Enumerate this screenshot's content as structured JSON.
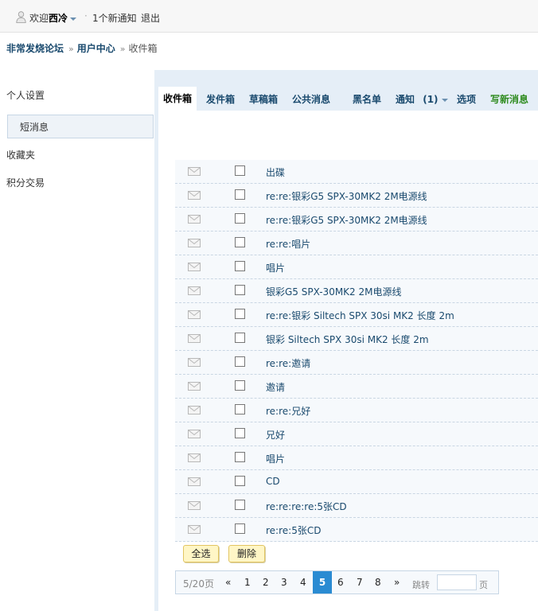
{
  "topbar": {
    "welcome_prefix": "欢迎",
    "username": "西冷",
    "separator": "·",
    "notice": "1个新通知",
    "logout": "退出"
  },
  "breadcrumb": {
    "forum": "非常发烧论坛",
    "sep": "»",
    "user_center": "用户中心",
    "current": "收件箱"
  },
  "sidebar": {
    "items": [
      "个人设置",
      "短消息",
      "收藏夹",
      "积分交易"
    ]
  },
  "tabs": {
    "inbox": "收件箱",
    "outbox": "发件箱",
    "drafts": "草稿箱",
    "public": "公共消息",
    "blacklist": "黑名单",
    "notice": "通知",
    "notice_count": "(1)",
    "options": "选项",
    "compose": "写新消息"
  },
  "messages": [
    "出碟",
    "re:re:银彩G5 SPX-30MK2 2M电源线",
    "re:re:银彩G5 SPX-30MK2 2M电源线",
    "re:re:唱片",
    "唱片",
    "银彩G5 SPX-30MK2 2M电源线",
    "re:re:银彩  Siltech SPX 30si MK2 长度  2m",
    "银彩  Siltech SPX 30si MK2 长度  2m",
    "re:re:邀请",
    "邀请",
    "re:re:兄好",
    "兄好",
    "唱片",
    "CD",
    "re:re:re:re:5张CD",
    "re:re:5张CD"
  ],
  "buttons": {
    "select_all": "全选",
    "delete": "删除"
  },
  "pager": {
    "info": "5/20页",
    "prev": "«",
    "pages": [
      "1",
      "2",
      "3",
      "4",
      "5",
      "6",
      "7",
      "8"
    ],
    "current": "5",
    "next": "»",
    "jump_label": "跳转",
    "page_unit": "页"
  },
  "colors": {
    "link": "#1a4a6e",
    "compose": "#2e8b1e",
    "current_page": "#2a8bd2",
    "panel_bg": "#e5eef7"
  }
}
